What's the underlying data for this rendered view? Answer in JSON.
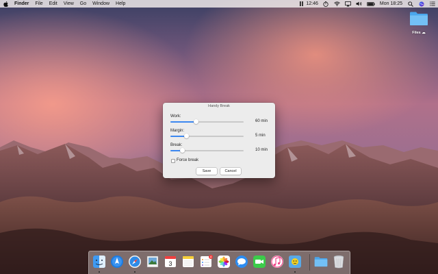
{
  "menubar": {
    "app_name": "Finder",
    "menus": [
      "File",
      "Edit",
      "View",
      "Go",
      "Window",
      "Help"
    ],
    "battery_time": "12:46",
    "clock": "Mon 18:25"
  },
  "desktop": {
    "files_label": "Files"
  },
  "dialog": {
    "title": "Handy Break",
    "work_label": "Work:",
    "work_value": "60 min",
    "work_level": 0.35,
    "margin_label": "Margin:",
    "margin_value": "5 min",
    "margin_level": 0.22,
    "break_label": "Break:",
    "break_value": "10 min",
    "break_level": 0.16,
    "force_break_label": "Force break",
    "force_break_checked": false,
    "save_label": "Save",
    "cancel_label": "Cancel",
    "accent_color": "#3b87f0"
  },
  "dock": {
    "calendar_day": "3",
    "reminders_badge": "4",
    "apps": [
      "finder-icon",
      "launchpad-icon",
      "safari-icon",
      "preview-icon",
      "calendar-icon",
      "notes-icon",
      "reminders-icon",
      "photos-icon",
      "messages-icon",
      "facetime-icon",
      "music-icon",
      "handy-break-icon",
      "folder-icon",
      "trash-icon"
    ]
  }
}
